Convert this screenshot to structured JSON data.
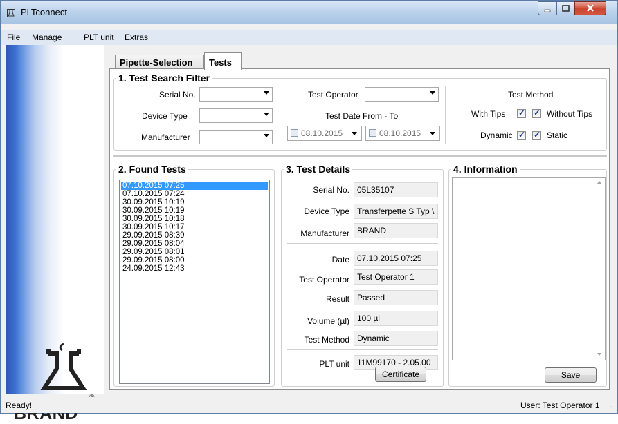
{
  "window": {
    "title": "PLTconnect",
    "brand": "BRAND",
    "brand_reg": "®"
  },
  "menu": [
    "File",
    "Manage",
    "PLT unit",
    "Extras"
  ],
  "tabs": {
    "pipette": "Pipette-Selection",
    "tests": "Tests"
  },
  "filter": {
    "legend": "1. Test Search Filter",
    "serial_label": "Serial No.",
    "device_type_label": "Device Type",
    "manufacturer_label": "Manufacturer",
    "operator_label": "Test Operator",
    "date_label": "Test Date From - To",
    "date_from": "08.10.2015",
    "date_to": "08.10.2015",
    "method_label": "Test Method",
    "with_tips": "With Tips",
    "without_tips": "Without Tips",
    "dynamic": "Dynamic",
    "static": "Static"
  },
  "found": {
    "legend": "2. Found Tests",
    "items": [
      "07.10.2015 07:25",
      "07.10.2015 07:24",
      "30.09.2015 10:19",
      "30.09.2015 10:19",
      "30.09.2015 10:18",
      "30.09.2015 10:17",
      "29.09.2015 08:39",
      "29.09.2015 08:04",
      "29.09.2015 08:01",
      "29.09.2015 08:00",
      "24.09.2015 12:43"
    ]
  },
  "details": {
    "legend": "3. Test Details",
    "serial_label": "Serial No.",
    "serial": "05L35107",
    "device_type_label": "Device Type",
    "device_type": "Transferpette S Typ \\",
    "manufacturer_label": "Manufacturer",
    "manufacturer": "BRAND",
    "date_label": "Date",
    "date": "07.10.2015 07:25",
    "operator_label": "Test Operator",
    "operator": "Test Operator 1",
    "result_label": "Result",
    "result": "Passed",
    "volume_label": "Volume (µl)",
    "volume": "100 µl",
    "method_label": "Test Method",
    "method": "Dynamic",
    "plt_label": "PLT unit",
    "plt": "11M99170  - 2.05.00",
    "certificate_button": "Certificate"
  },
  "info": {
    "legend": "4. Information",
    "save_button": "Save"
  },
  "status": {
    "left": "Ready!",
    "right": "User: Test Operator 1"
  }
}
